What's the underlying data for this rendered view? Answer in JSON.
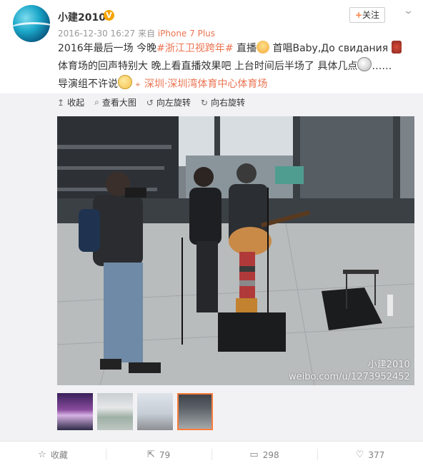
{
  "post": {
    "username": "小建2010",
    "verified_badge": "V",
    "timestamp": "2016-12-30 16:27",
    "source_prefix": "来自",
    "source_device": "iPhone 7 Plus",
    "follow_label": "关注",
    "follow_plus": "+",
    "more_icon": "chevron-down-icon",
    "content": {
      "line1_a": "2016年最后一场  今晚",
      "hashtag": "#浙江卫视跨年#",
      "line1_b": " 直播",
      "line1_c": "  首唱Baby,До свидания",
      "line2_a": "  体育场的回声特别大  晚上看直播效果吧  上台时间后半场了  具体几点",
      "line2_b": "……",
      "line3_a": "导演组不许说",
      "location": "深圳·深圳湾体育中心体育场"
    }
  },
  "toolbar": {
    "collapse_label": "收起",
    "view_large_label": "查看大图",
    "rotate_left_label": "向左旋转",
    "rotate_right_label": "向右旋转"
  },
  "photo": {
    "watermark_line1": "小建2010",
    "watermark_line2": "weibo.com/u/1273952452"
  },
  "thumbnails": [
    "thumb-1",
    "thumb-2",
    "thumb-3",
    "thumb-4"
  ],
  "actions": {
    "favorite_label": "收藏",
    "repost_count": "79",
    "comment_count": "298",
    "like_count": "377"
  },
  "colors": {
    "accent": "#eb7350",
    "selected_thumb": "#fa7d3c",
    "badge": "#f7a400"
  }
}
